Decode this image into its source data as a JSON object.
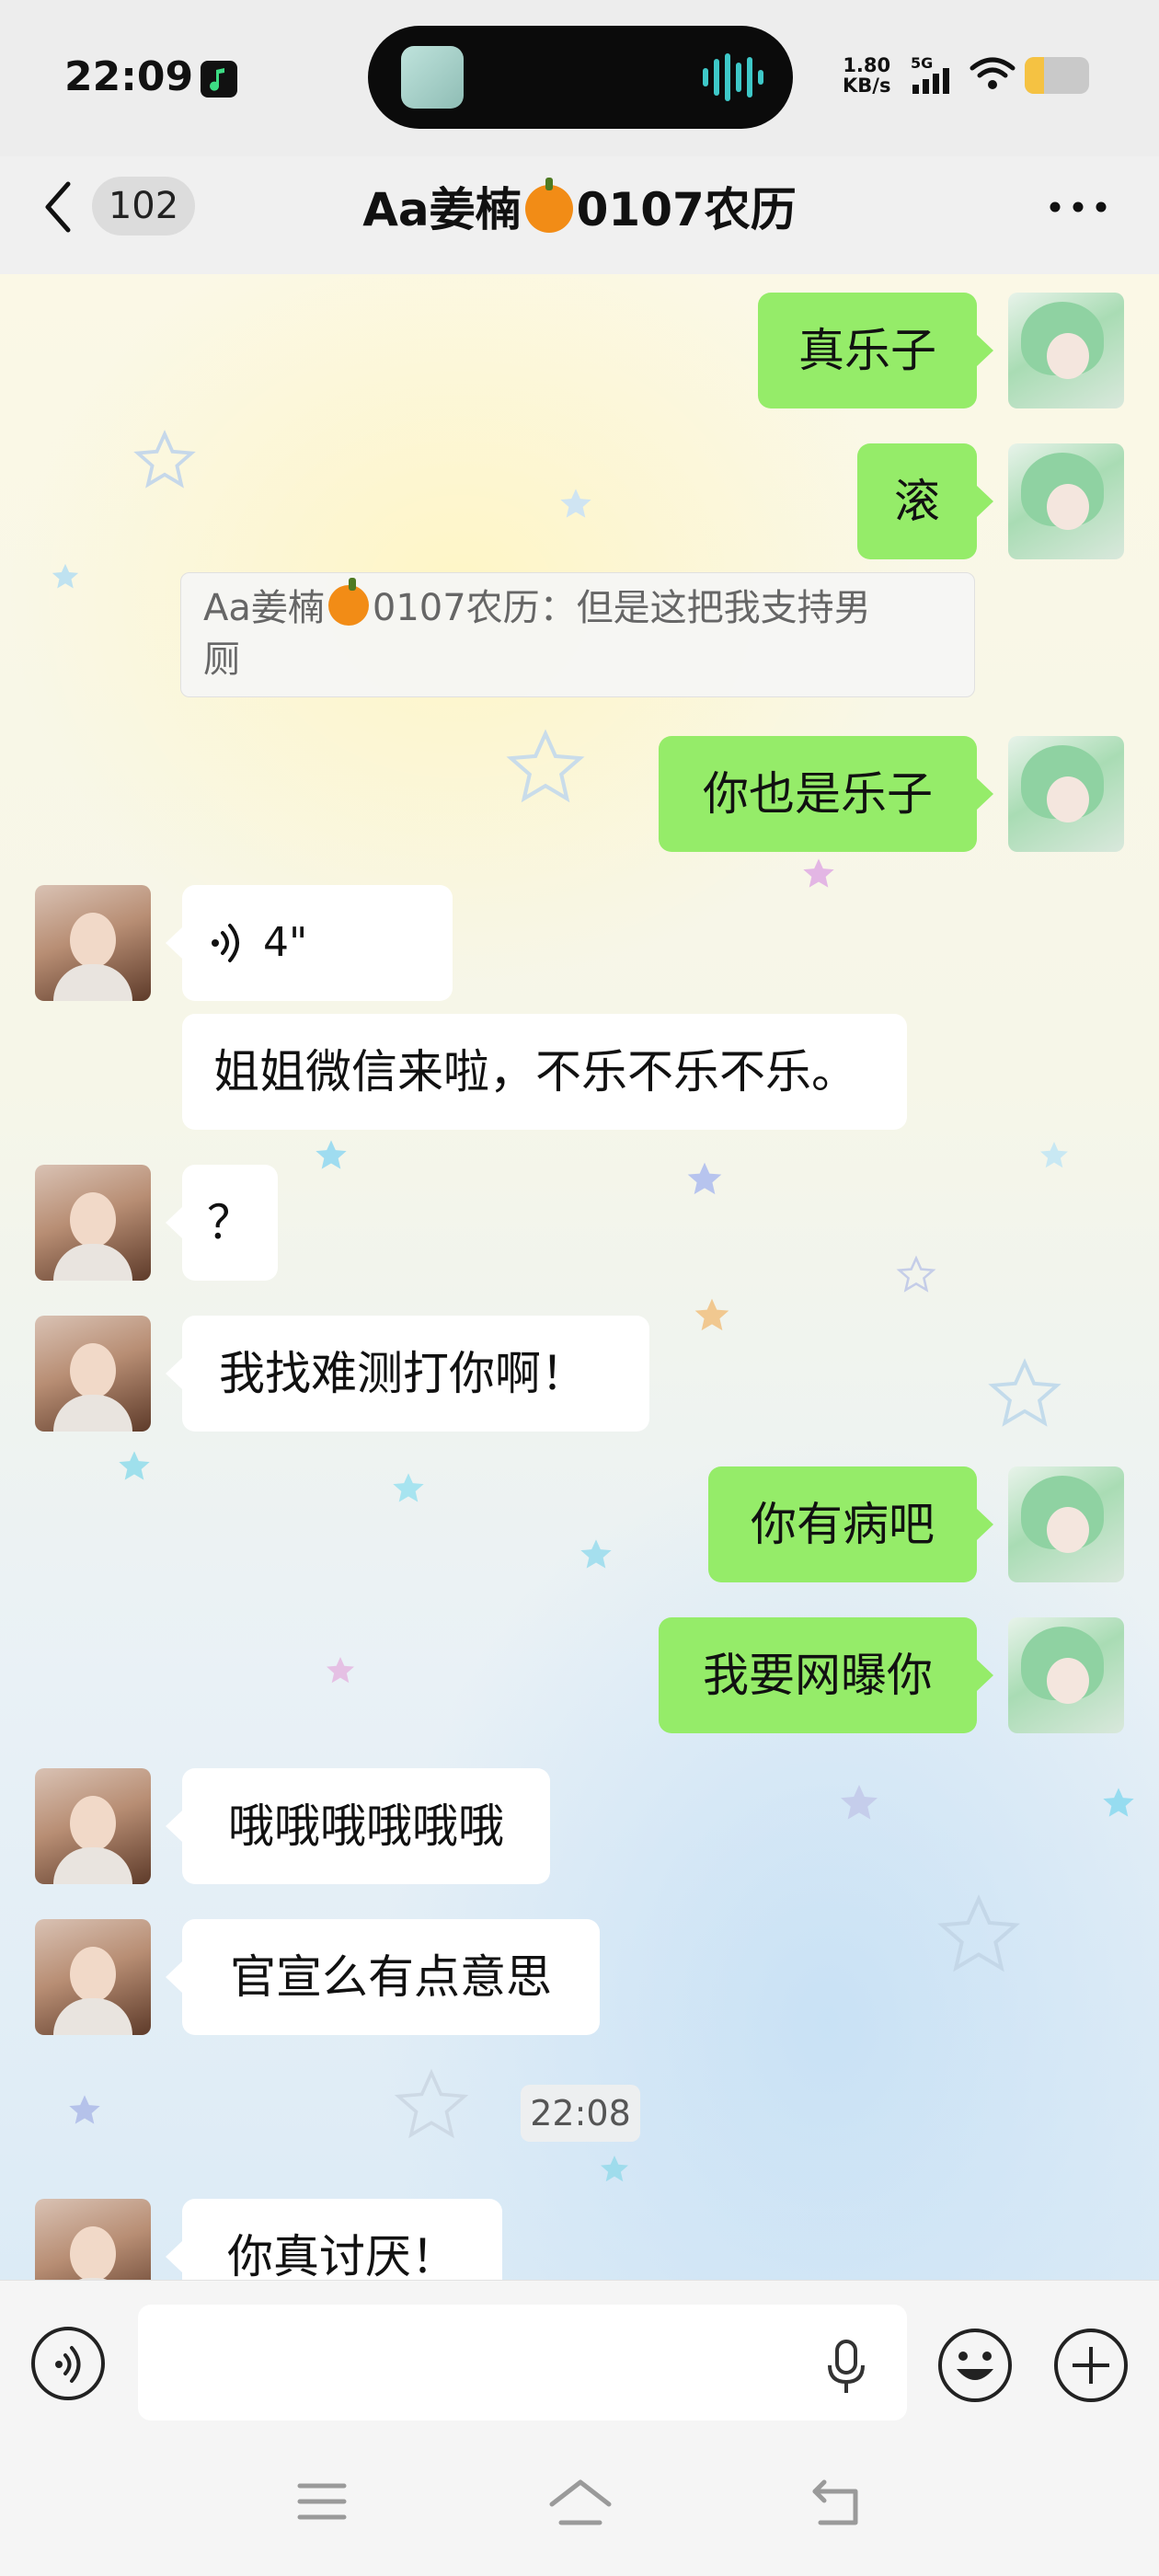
{
  "status_bar": {
    "time": "22:09",
    "net_speed_value": "1.80",
    "net_speed_unit": "KB/s",
    "network_type": "5G",
    "battery_level": 0.3
  },
  "header": {
    "unread_count": "102",
    "title_prefix": "Aa姜楠",
    "title_suffix": "0107农历"
  },
  "messages": [
    {
      "side": "out",
      "text": "真乐子"
    },
    {
      "side": "out",
      "text": "滚"
    },
    {
      "side": "quote",
      "text": "Aa姜楠🎃0107农历：但是这把我支持男厕"
    },
    {
      "side": "out",
      "text": "你也是乐子"
    },
    {
      "side": "in",
      "type": "voice",
      "duration": "4\""
    },
    {
      "side": "in",
      "text": "姐姐微信来啦，不乐不乐不乐。"
    },
    {
      "side": "in",
      "text": "？"
    },
    {
      "side": "in",
      "text": "我找难测打你啊！"
    },
    {
      "side": "out",
      "text": "你有病吧"
    },
    {
      "side": "out",
      "text": "我要网曝你"
    },
    {
      "side": "in",
      "text": "哦哦哦哦哦哦"
    },
    {
      "side": "in",
      "text": "官宣么有点意思"
    },
    {
      "side": "time",
      "text": "22:08"
    },
    {
      "side": "in",
      "text": "你真讨厌！"
    }
  ],
  "quote": {
    "sender_prefix": "Aa姜楠",
    "line1_suffix": "0107农历：但是这把我支持男",
    "line2": "厕"
  },
  "input": {
    "placeholder": ""
  },
  "colors": {
    "outgoing_bubble": "#95ec69",
    "incoming_bubble": "#ffffff",
    "battery": "#f5c242"
  }
}
